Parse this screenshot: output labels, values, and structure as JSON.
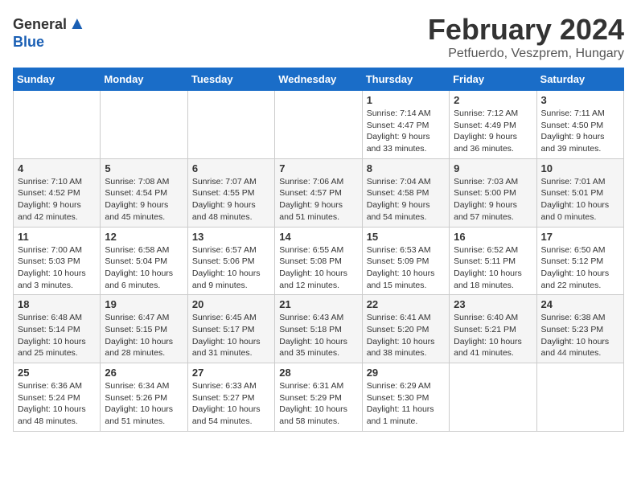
{
  "header": {
    "logo_general": "General",
    "logo_blue": "Blue",
    "month_year": "February 2024",
    "location": "Petfuerdo, Veszprem, Hungary"
  },
  "calendar": {
    "days_of_week": [
      "Sunday",
      "Monday",
      "Tuesday",
      "Wednesday",
      "Thursday",
      "Friday",
      "Saturday"
    ],
    "weeks": [
      [
        {
          "day": "",
          "info": ""
        },
        {
          "day": "",
          "info": ""
        },
        {
          "day": "",
          "info": ""
        },
        {
          "day": "",
          "info": ""
        },
        {
          "day": "1",
          "info": "Sunrise: 7:14 AM\nSunset: 4:47 PM\nDaylight: 9 hours\nand 33 minutes."
        },
        {
          "day": "2",
          "info": "Sunrise: 7:12 AM\nSunset: 4:49 PM\nDaylight: 9 hours\nand 36 minutes."
        },
        {
          "day": "3",
          "info": "Sunrise: 7:11 AM\nSunset: 4:50 PM\nDaylight: 9 hours\nand 39 minutes."
        }
      ],
      [
        {
          "day": "4",
          "info": "Sunrise: 7:10 AM\nSunset: 4:52 PM\nDaylight: 9 hours\nand 42 minutes."
        },
        {
          "day": "5",
          "info": "Sunrise: 7:08 AM\nSunset: 4:54 PM\nDaylight: 9 hours\nand 45 minutes."
        },
        {
          "day": "6",
          "info": "Sunrise: 7:07 AM\nSunset: 4:55 PM\nDaylight: 9 hours\nand 48 minutes."
        },
        {
          "day": "7",
          "info": "Sunrise: 7:06 AM\nSunset: 4:57 PM\nDaylight: 9 hours\nand 51 minutes."
        },
        {
          "day": "8",
          "info": "Sunrise: 7:04 AM\nSunset: 4:58 PM\nDaylight: 9 hours\nand 54 minutes."
        },
        {
          "day": "9",
          "info": "Sunrise: 7:03 AM\nSunset: 5:00 PM\nDaylight: 9 hours\nand 57 minutes."
        },
        {
          "day": "10",
          "info": "Sunrise: 7:01 AM\nSunset: 5:01 PM\nDaylight: 10 hours\nand 0 minutes."
        }
      ],
      [
        {
          "day": "11",
          "info": "Sunrise: 7:00 AM\nSunset: 5:03 PM\nDaylight: 10 hours\nand 3 minutes."
        },
        {
          "day": "12",
          "info": "Sunrise: 6:58 AM\nSunset: 5:04 PM\nDaylight: 10 hours\nand 6 minutes."
        },
        {
          "day": "13",
          "info": "Sunrise: 6:57 AM\nSunset: 5:06 PM\nDaylight: 10 hours\nand 9 minutes."
        },
        {
          "day": "14",
          "info": "Sunrise: 6:55 AM\nSunset: 5:08 PM\nDaylight: 10 hours\nand 12 minutes."
        },
        {
          "day": "15",
          "info": "Sunrise: 6:53 AM\nSunset: 5:09 PM\nDaylight: 10 hours\nand 15 minutes."
        },
        {
          "day": "16",
          "info": "Sunrise: 6:52 AM\nSunset: 5:11 PM\nDaylight: 10 hours\nand 18 minutes."
        },
        {
          "day": "17",
          "info": "Sunrise: 6:50 AM\nSunset: 5:12 PM\nDaylight: 10 hours\nand 22 minutes."
        }
      ],
      [
        {
          "day": "18",
          "info": "Sunrise: 6:48 AM\nSunset: 5:14 PM\nDaylight: 10 hours\nand 25 minutes."
        },
        {
          "day": "19",
          "info": "Sunrise: 6:47 AM\nSunset: 5:15 PM\nDaylight: 10 hours\nand 28 minutes."
        },
        {
          "day": "20",
          "info": "Sunrise: 6:45 AM\nSunset: 5:17 PM\nDaylight: 10 hours\nand 31 minutes."
        },
        {
          "day": "21",
          "info": "Sunrise: 6:43 AM\nSunset: 5:18 PM\nDaylight: 10 hours\nand 35 minutes."
        },
        {
          "day": "22",
          "info": "Sunrise: 6:41 AM\nSunset: 5:20 PM\nDaylight: 10 hours\nand 38 minutes."
        },
        {
          "day": "23",
          "info": "Sunrise: 6:40 AM\nSunset: 5:21 PM\nDaylight: 10 hours\nand 41 minutes."
        },
        {
          "day": "24",
          "info": "Sunrise: 6:38 AM\nSunset: 5:23 PM\nDaylight: 10 hours\nand 44 minutes."
        }
      ],
      [
        {
          "day": "25",
          "info": "Sunrise: 6:36 AM\nSunset: 5:24 PM\nDaylight: 10 hours\nand 48 minutes."
        },
        {
          "day": "26",
          "info": "Sunrise: 6:34 AM\nSunset: 5:26 PM\nDaylight: 10 hours\nand 51 minutes."
        },
        {
          "day": "27",
          "info": "Sunrise: 6:33 AM\nSunset: 5:27 PM\nDaylight: 10 hours\nand 54 minutes."
        },
        {
          "day": "28",
          "info": "Sunrise: 6:31 AM\nSunset: 5:29 PM\nDaylight: 10 hours\nand 58 minutes."
        },
        {
          "day": "29",
          "info": "Sunrise: 6:29 AM\nSunset: 5:30 PM\nDaylight: 11 hours\nand 1 minute."
        },
        {
          "day": "",
          "info": ""
        },
        {
          "day": "",
          "info": ""
        }
      ]
    ]
  }
}
